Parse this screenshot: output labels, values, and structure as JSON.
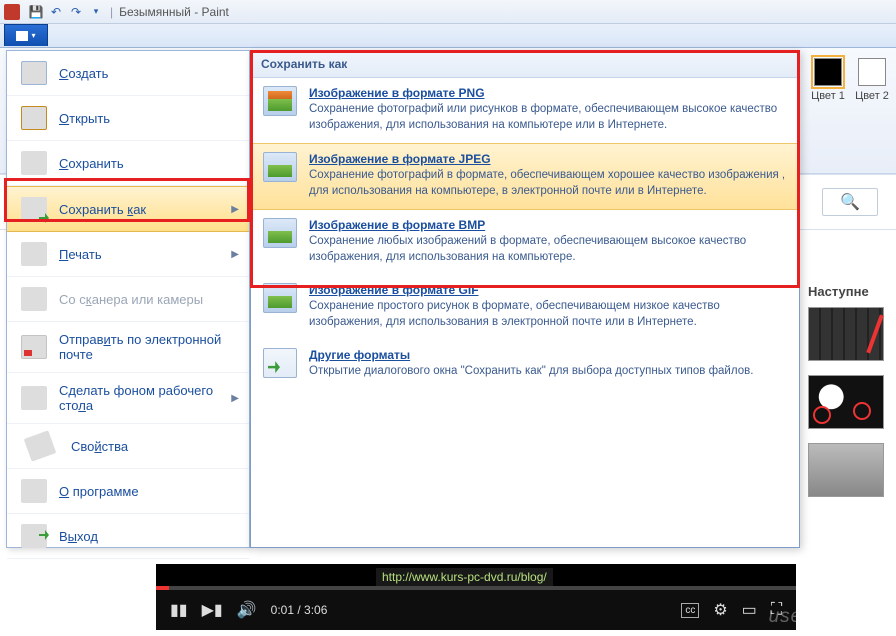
{
  "window": {
    "title": "Безымянный - Paint"
  },
  "ribbon": {
    "colors": [
      {
        "label": "Цвет 1",
        "color": "#000000",
        "selected": true
      },
      {
        "label": "Цвет 2",
        "color": "#ffffff",
        "selected": false
      }
    ]
  },
  "file_menu": {
    "items": [
      {
        "id": "new",
        "label_pre": "",
        "label_u": "С",
        "label_post": "оздать"
      },
      {
        "id": "open",
        "label_pre": "",
        "label_u": "О",
        "label_post": "ткрыть"
      },
      {
        "id": "save",
        "label_pre": "",
        "label_u": "С",
        "label_post": "охранить"
      },
      {
        "id": "saveas",
        "label_pre": "Сохранить ",
        "label_u": "к",
        "label_post": "ак",
        "submenu": true,
        "active": true
      },
      {
        "id": "print",
        "label_pre": "",
        "label_u": "П",
        "label_post": "ечать",
        "submenu": true
      },
      {
        "id": "scanner",
        "label_pre": "Со с",
        "label_u": "к",
        "label_post": "анера или камеры",
        "disabled": true
      },
      {
        "id": "sendmail",
        "label_pre": "Отправ",
        "label_u": "и",
        "label_post": "ть по электронной почте"
      },
      {
        "id": "setbg",
        "label_pre": "Сделать фоном рабочего сто",
        "label_u": "л",
        "label_post": "а",
        "submenu": true
      },
      {
        "id": "props",
        "label_pre": "Сво",
        "label_u": "й",
        "label_post": "ства"
      },
      {
        "id": "about",
        "label_pre": "",
        "label_u": "О",
        "label_post": " программе"
      },
      {
        "id": "exit",
        "label_pre": "В",
        "label_u": "ы",
        "label_post": "ход"
      }
    ]
  },
  "saveas": {
    "header": "Сохранить как",
    "formats": [
      {
        "id": "png",
        "title": "Изображение в формате PNG",
        "desc": "Сохранение фотографий или рисунков в формате, обеспечивающем высокое качество изображения, для использования на компьютере или в Интернете."
      },
      {
        "id": "jpeg",
        "title": "Изображение в формате JPEG",
        "hover": true,
        "desc": "Сохранение фотографий в формате, обеспечивающем хорошее качество изображения , для использования на компьютере, в электронной почте или в Интернете."
      },
      {
        "id": "bmp",
        "title": "Изображение в формате BMP",
        "desc": "Сохранение любых изображений в формате, обеспечивающем высокое качество изображения, для использования на компьютере."
      },
      {
        "id": "gif",
        "title": "Изображение в формате GIF",
        "desc": "Сохранение простого рисунок в формате, обеспечивающем низкое качество изображения, для использования в электронной почте или в Интернете."
      },
      {
        "id": "other",
        "title": "Другие форматы",
        "desc": "Открытие диалогового окна \"Сохранить как\" для выбора доступных типов файлов."
      }
    ]
  },
  "next": {
    "heading": "Наступне"
  },
  "video": {
    "time_current": "0:01",
    "time_total": "3:06",
    "url": "http://www.kurs-pc-dvd.ru/blog/"
  },
  "watermark": "user-life.com"
}
